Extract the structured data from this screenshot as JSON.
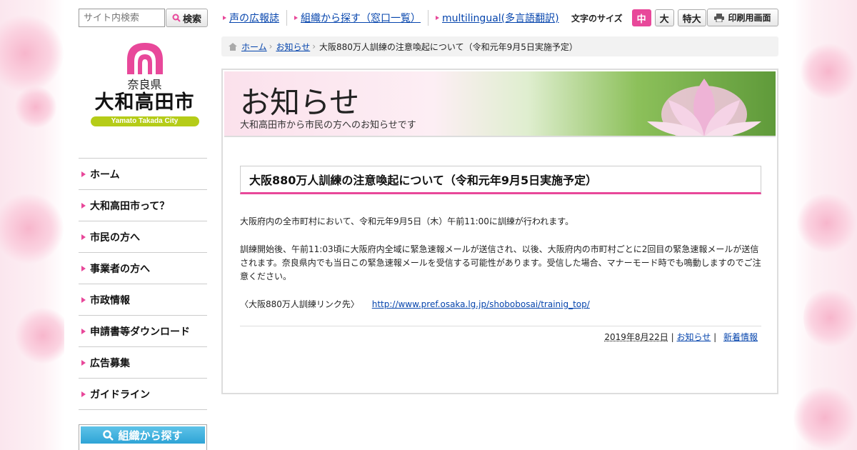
{
  "search": {
    "placeholder": "サイト内検索",
    "button_label": "検索"
  },
  "logo": {
    "prefecture": "奈良県",
    "city": "大和高田市",
    "english": "Yamato Takada City"
  },
  "nav": {
    "items": [
      {
        "label": "ホーム"
      },
      {
        "label": "大和高田市って？"
      },
      {
        "label": "市民の方へ"
      },
      {
        "label": "事業者の方へ"
      },
      {
        "label": "市政情報"
      },
      {
        "label": "申請書等ダウンロード"
      },
      {
        "label": "広告募集"
      },
      {
        "label": "ガイドライン"
      }
    ],
    "org_search_label": "組織から探す"
  },
  "header": {
    "links": [
      {
        "label": "声の広報誌"
      },
      {
        "label": "組織から探す（窓口一覧）"
      },
      {
        "label": "multilingual(多言語翻訳)"
      }
    ],
    "font_size_label": "文字のサイズ",
    "font_sizes": [
      "中",
      "大",
      "特大"
    ],
    "print_label": "印刷用画面"
  },
  "breadcrumb": {
    "home": "ホーム",
    "section": "お知らせ",
    "current": "大阪880万人訓練の注意喚起について（令和元年9月5日実施予定）"
  },
  "banner": {
    "title": "お知らせ",
    "subtitle": "大和高田市から市民の方へのお知らせです"
  },
  "article": {
    "title": "大阪880万人訓練の注意喚起について（令和元年9月5日実施予定）",
    "paragraph1": "大阪府内の全市町村において、令和元年9月5日（木）午前11:00に訓練が行われます。",
    "paragraph2": "訓練開始後、午前11:03頃に大阪府内全域に緊急速報メールが送信され、以後、大阪府内の市町村ごとに2回目の緊急速報メールが送信されます。奈良県内でも当日この緊急速報メールを受信する可能性があります。受信した場合、マナーモード時でも鳴動しますのでご注意ください。",
    "link_label": "〈大阪880万人訓練リンク先〉",
    "link_url": "http://www.pref.osaka.lg.jp/shobobosai/trainig_top/",
    "date": "2019年8月22日",
    "sep": "|",
    "category": "お知らせ",
    "tag": "新着情報"
  },
  "colors": {
    "accent": "#e8489a",
    "link": "#0645ad",
    "logo_green": "#b5cc18",
    "org_blue": "#2ea4d6"
  }
}
